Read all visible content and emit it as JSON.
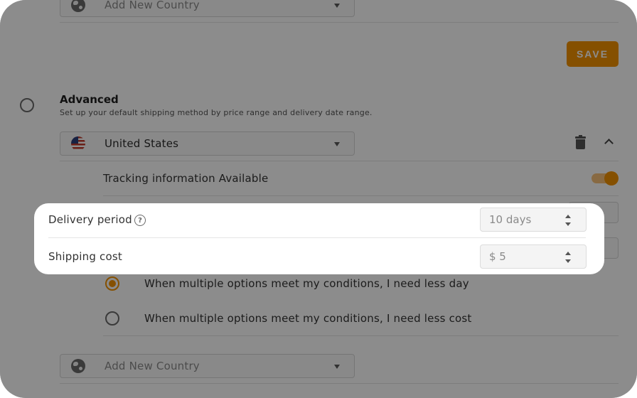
{
  "top_country": {
    "placeholder": "Add New Country",
    "icon": "globe-icon"
  },
  "save_label": "SAVE",
  "advanced": {
    "title": "Advanced",
    "description": "Set up your default shipping method by price range and delivery date range."
  },
  "country_select": {
    "value": "United States",
    "icon": "us-flag-icon"
  },
  "tracking": {
    "label": "Tracking information Available",
    "enabled": true
  },
  "delivery": {
    "label": "Delivery period",
    "value": "10 days"
  },
  "shipping": {
    "label": "Shipping cost",
    "value": "$ 5"
  },
  "preferences": [
    {
      "label": "When multiple options meet my conditions, I need less day",
      "selected": true
    },
    {
      "label": "When multiple options meet my conditions, I need less cost",
      "selected": false
    }
  ],
  "bottom_country": {
    "placeholder": "Add New Country",
    "icon": "globe-icon"
  },
  "colors": {
    "accent": "#f39200",
    "overlay": "rgba(0,0,0,0.45)"
  }
}
